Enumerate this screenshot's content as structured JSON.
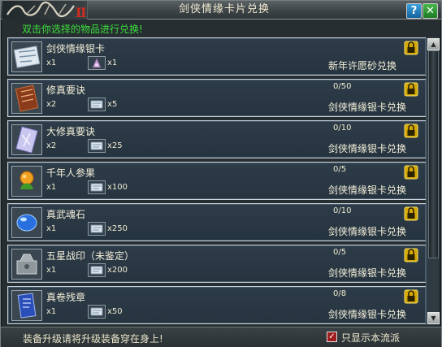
{
  "window": {
    "title": "剑侠情缘卡片兑换",
    "subtitle": "双击你选择的物品进行兑换!",
    "help_label": "?",
    "close_label": "✕",
    "logo_icon": "game-logo-icon"
  },
  "items": [
    {
      "name": "剑侠情缘银卡",
      "qty": "x1",
      "cost_qty": "x1",
      "progress": "",
      "exchange": "新年许愿砂兑换",
      "icon": "silver-card-icon",
      "cost_icon": "wish-sand-icon"
    },
    {
      "name": "修真要诀",
      "qty": "x2",
      "cost_qty": "x5",
      "progress": "0/50",
      "exchange": "剑侠情缘银卡兑换",
      "icon": "book-icon",
      "cost_icon": "silver-card-icon"
    },
    {
      "name": "大修真要诀",
      "qty": "x2",
      "cost_qty": "x25",
      "progress": "0/10",
      "exchange": "剑侠情缘银卡兑换",
      "icon": "crystal-card-icon",
      "cost_icon": "silver-card-icon"
    },
    {
      "name": "千年人参果",
      "qty": "x1",
      "cost_qty": "x100",
      "progress": "0/5",
      "exchange": "剑侠情缘银卡兑换",
      "icon": "ginseng-fruit-icon",
      "cost_icon": "silver-card-icon"
    },
    {
      "name": "真武魂石",
      "qty": "x1",
      "cost_qty": "x250",
      "progress": "0/10",
      "exchange": "剑侠情缘银卡兑换",
      "icon": "soul-stone-icon",
      "cost_icon": "silver-card-icon"
    },
    {
      "name": "五星战印（未鉴定）",
      "qty": "x1",
      "cost_qty": "x200",
      "progress": "0/5",
      "exchange": "剑侠情缘银卡兑换",
      "icon": "seal-box-icon",
      "cost_icon": "silver-card-icon"
    },
    {
      "name": "真卷残章",
      "qty": "x1",
      "cost_qty": "x50",
      "progress": "0/8",
      "exchange": "剑侠情缘银卡兑换",
      "icon": "blue-scroll-icon",
      "cost_icon": "silver-card-icon"
    }
  ],
  "footer": {
    "hint": "装备升级请将升级装备穿在身上!",
    "checkbox_label": "只显示本流派",
    "checkbox_checked": true,
    "checkbox_mark": "✓"
  },
  "scrollbar": {
    "up_label": "▲",
    "down_label": "▼"
  },
  "colors": {
    "subtitle": "#3cde3c",
    "row_bg": "#2b3a46",
    "checkbox": "#9e1d1d"
  }
}
